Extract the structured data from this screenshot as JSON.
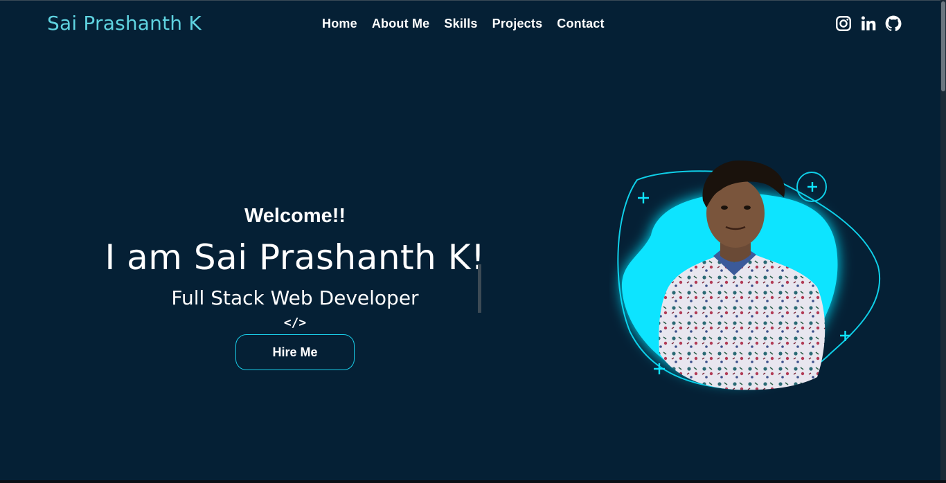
{
  "brand": {
    "name": "Sai Prashanth K"
  },
  "nav": {
    "items": [
      {
        "label": "Home"
      },
      {
        "label": "About Me"
      },
      {
        "label": "Skills"
      },
      {
        "label": "Projects"
      },
      {
        "label": "Contact"
      }
    ]
  },
  "socials": [
    {
      "icon": "instagram-icon"
    },
    {
      "icon": "linkedin-icon"
    },
    {
      "icon": "github-icon"
    }
  ],
  "hero": {
    "welcome": "Welcome!!",
    "headline": "I am Sai Prashanth K!",
    "role": "Full Stack Web Developer",
    "code_symbol": "</>",
    "cta_label": "Hire Me"
  },
  "colors": {
    "background": "#052035",
    "accent": "#0fe4ff",
    "brand": "#5fd3e0"
  }
}
